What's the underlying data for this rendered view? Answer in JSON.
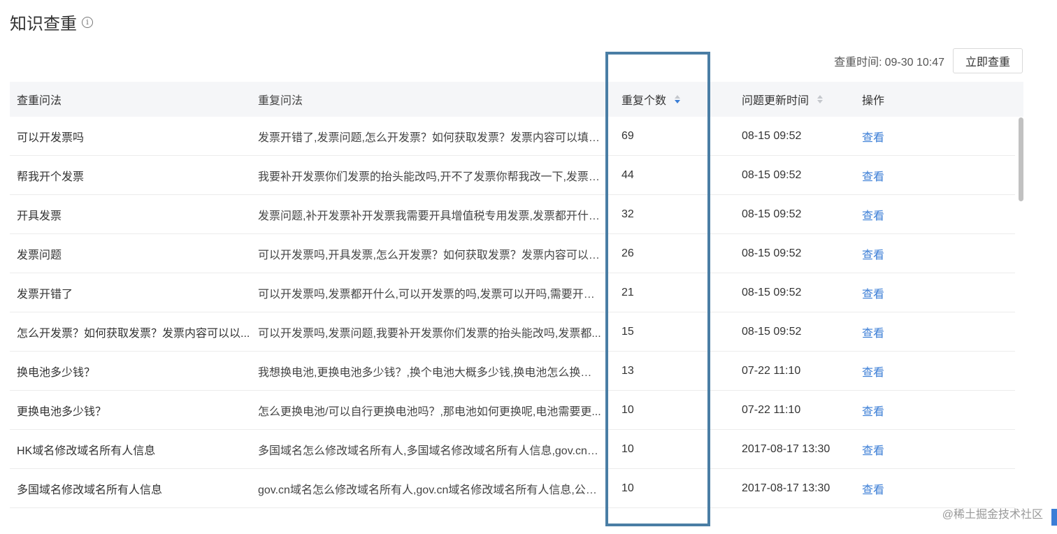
{
  "header": {
    "title": "知识查重",
    "info_icon": "ⓘ"
  },
  "toolbar": {
    "check_time_label": "查重时间:",
    "check_time_value": "09-30 10:47",
    "check_button": "立即查重"
  },
  "table": {
    "columns": {
      "query": "查重问法",
      "duplicates": "重复问法",
      "count": "重复个数",
      "updated": "问题更新时间",
      "action": "操作"
    },
    "sort": {
      "count": "desc",
      "updated": "none"
    },
    "rows": [
      {
        "query": "可以开发票吗",
        "duplicates": "发票开错了,发票问题,怎么开发票？如何获取发票？发票内容可以填写...",
        "count": "69",
        "updated": "08-15 09:52",
        "action": "查看"
      },
      {
        "query": "帮我开个发票",
        "duplicates": "我要补开发票你们发票的抬头能改吗,开不了发票你帮我改一下,发票都...",
        "count": "44",
        "updated": "08-15 09:52",
        "action": "查看"
      },
      {
        "query": "开具发票",
        "duplicates": "发票问题,补开发票补开发票我需要开具增值税专用发票,发票都开什么...",
        "count": "32",
        "updated": "08-15 09:52",
        "action": "查看"
      },
      {
        "query": "发票问题",
        "duplicates": "可以开发票吗,开具发票,怎么开发票？如何获取发票？发票内容可以填...",
        "count": "26",
        "updated": "08-15 09:52",
        "action": "查看"
      },
      {
        "query": "发票开错了",
        "duplicates": "可以开发票吗,发票都开什么,可以开发票的吗,发票可以开吗,需要开发...",
        "count": "21",
        "updated": "08-15 09:52",
        "action": "查看"
      },
      {
        "query": "怎么开发票？如何获取发票？发票内容可以以...",
        "duplicates": "可以开发票吗,发票问题,我要补开发票你们发票的抬头能改吗,发票都...",
        "count": "15",
        "updated": "08-15 09:52",
        "action": "查看"
      },
      {
        "query": "换电池多少钱？",
        "duplicates": "我想换电池,更换电池多少钱？,换个电池大概多少钱,换电池怎么换？,...",
        "count": "13",
        "updated": "07-22 11:10",
        "action": "查看"
      },
      {
        "query": "更换电池多少钱？",
        "duplicates": "怎么更换电池/可以自行更换电池吗？,那电池如何更换呢,电池需要更...",
        "count": "10",
        "updated": "07-22 11:10",
        "action": "查看"
      },
      {
        "query": "HK域名修改域名所有人信息",
        "duplicates": "多国域名怎么修改域名所有人,多国域名修改域名所有人信息,gov.cn域...",
        "count": "10",
        "updated": "2017-08-17 13:30",
        "action": "查看"
      },
      {
        "query": "多国域名修改域名所有人信息",
        "duplicates": "gov.cn域名怎么修改域名所有人,gov.cn域名修改域名所有人信息,公司...",
        "count": "10",
        "updated": "2017-08-17 13:30",
        "action": "查看"
      }
    ]
  },
  "watermark": "@稀土掘金技术社区",
  "colors": {
    "link": "#3b7ed6",
    "header_bg": "#f5f6f8",
    "highlight_border": "#4a7ea5"
  }
}
